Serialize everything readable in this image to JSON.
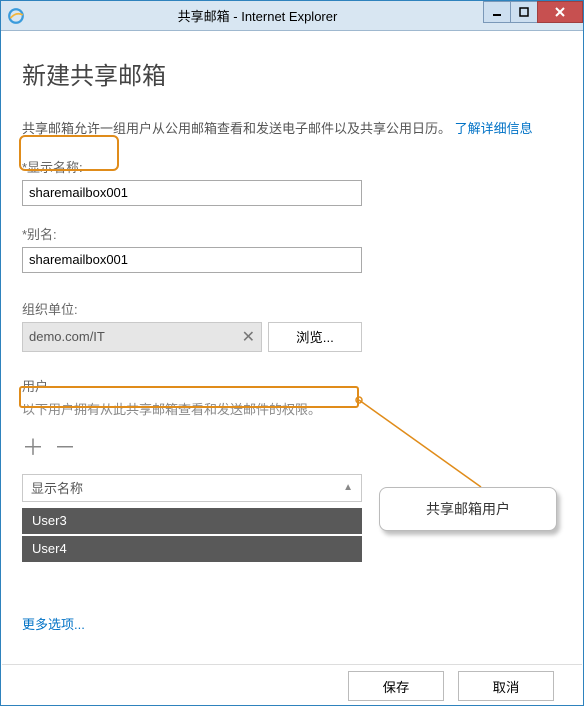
{
  "window": {
    "title": "共享邮箱 - Internet Explorer"
  },
  "page": {
    "heading": "新建共享邮箱",
    "description": "共享邮箱允许一组用户从公用邮箱查看和发送电子邮件以及共享公用日历。",
    "learn_more": "了解详细信息"
  },
  "fields": {
    "display_name_label": "*显示名称:",
    "display_name_value": "sharemailbox001",
    "alias_label": "*别名:",
    "alias_value": "sharemailbox001",
    "ou_label": "组织单位:",
    "ou_value": "demo.com/IT",
    "browse_label": "浏览...",
    "users_label": "用户",
    "users_subdesc": "以下用户拥有从此共享邮箱查看和发送邮件的权限。",
    "list_header": "显示名称"
  },
  "users": {
    "0": "User3",
    "1": "User4"
  },
  "callout": {
    "text": "共享邮箱用户"
  },
  "footer": {
    "more": "更多选项...",
    "save": "保存",
    "cancel": "取消"
  }
}
